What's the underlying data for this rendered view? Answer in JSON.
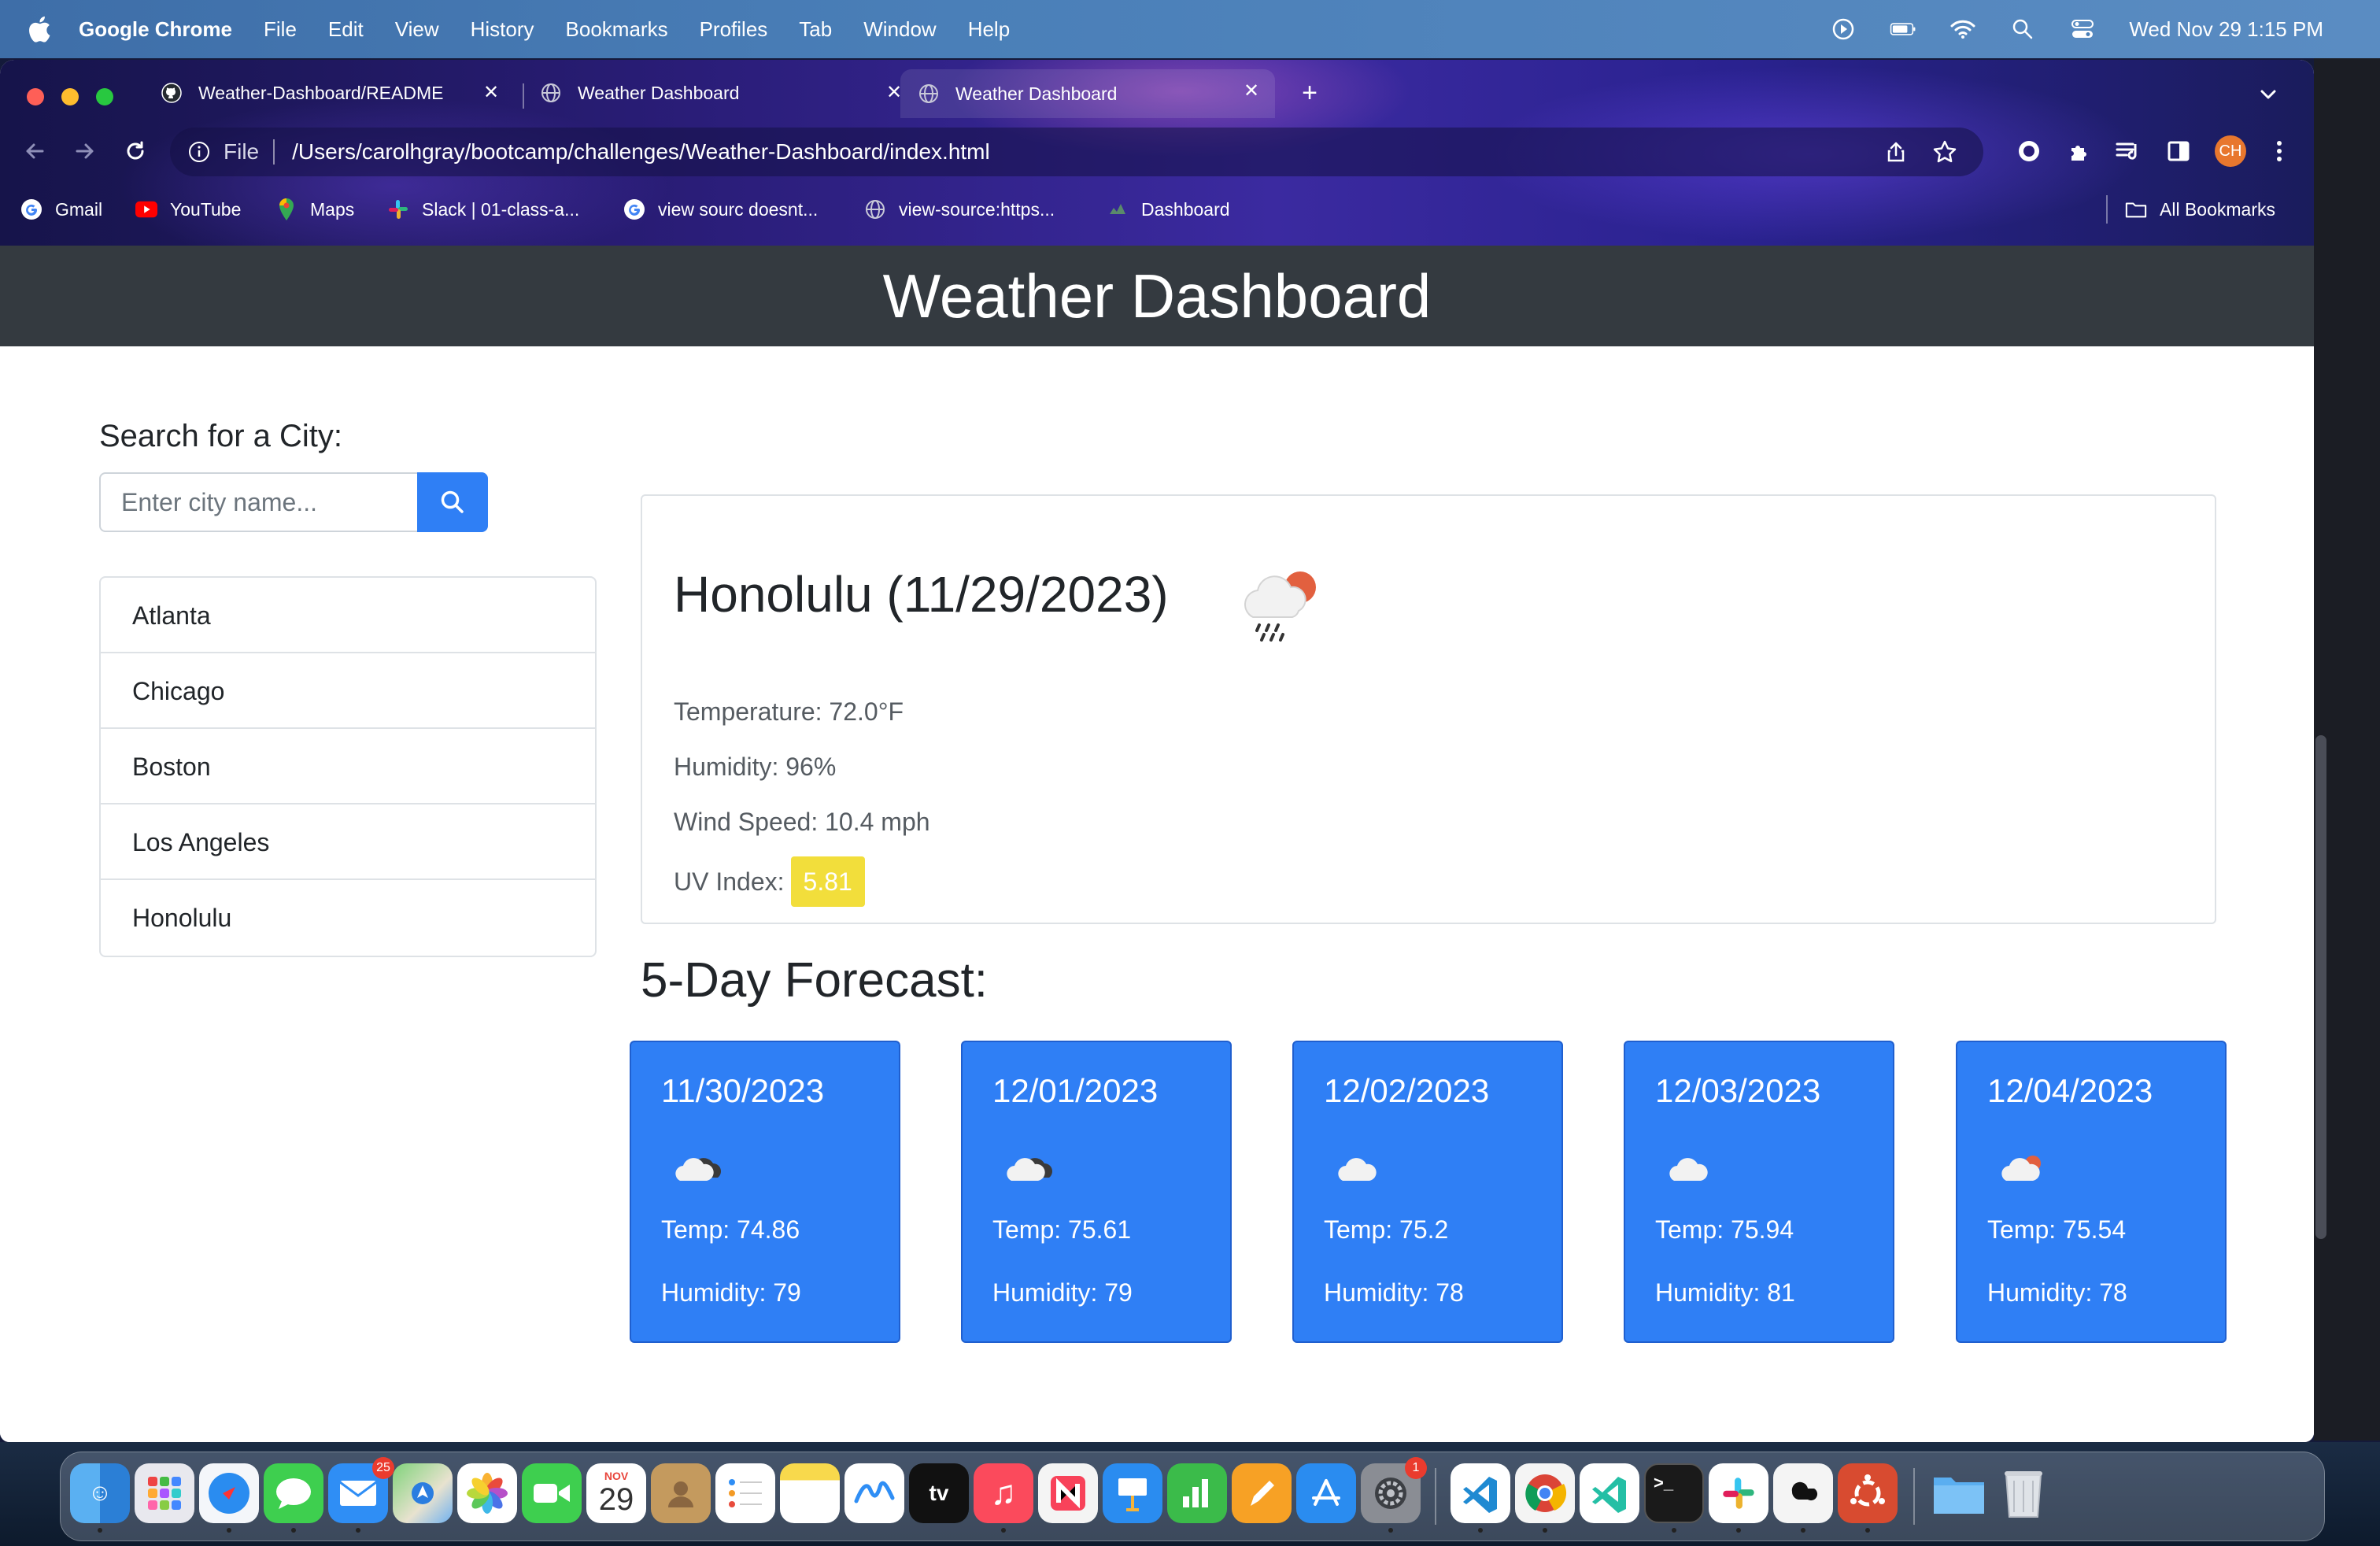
{
  "menubar": {
    "app": "Google Chrome",
    "items": [
      "File",
      "Edit",
      "View",
      "History",
      "Bookmarks",
      "Profiles",
      "Tab",
      "Window",
      "Help"
    ],
    "clock": "Wed Nov 29  1:15 PM"
  },
  "tabs": [
    {
      "title": "Weather-Dashboard/README",
      "icon": "github-icon"
    },
    {
      "title": "Weather Dashboard",
      "icon": "globe-icon"
    },
    {
      "title": "Weather Dashboard",
      "icon": "globe-icon",
      "active": true
    }
  ],
  "omnibox": {
    "scheme": "File",
    "url": "/Users/carolhgray/bootcamp/challenges/Weather-Dashboard/index.html"
  },
  "profile_initials": "CH",
  "bookmarks": [
    {
      "label": "Gmail",
      "icon": "google-icon"
    },
    {
      "label": "YouTube",
      "icon": "youtube-icon"
    },
    {
      "label": "Maps",
      "icon": "maps-pin-icon"
    },
    {
      "label": "Slack | 01-class-a...",
      "icon": "slack-icon"
    },
    {
      "label": "view sourc doesnt...",
      "icon": "google-icon"
    },
    {
      "label": "view-source:https...",
      "icon": "globe-icon"
    },
    {
      "label": "Dashboard",
      "icon": "dashboard-icon"
    }
  ],
  "all_bookmarks": "All Bookmarks",
  "page": {
    "header": "Weather Dashboard",
    "search_title": "Search for a City:",
    "search_placeholder": "Enter city name...",
    "cities": [
      "Atlanta",
      "Chicago",
      "Boston",
      "Los Angeles",
      "Honolulu"
    ],
    "current": {
      "title": "Honolulu (11/29/2023)",
      "icon": "rain-cloud-sun-icon",
      "temperature": "Temperature: 72.0°F",
      "humidity": "Humidity: 96%",
      "wind": "Wind Speed: 10.4 mph",
      "uv_label": "UV Index:",
      "uv_value": "5.81",
      "uv_color": "#f2de3b"
    },
    "forecast_title": "5-Day Forecast:",
    "forecast": [
      {
        "date": "11/30/2023",
        "icon": "broken-clouds-icon",
        "temp": "Temp: 74.86",
        "humidity": "Humidity: 79"
      },
      {
        "date": "12/01/2023",
        "icon": "broken-clouds-icon",
        "temp": "Temp: 75.61",
        "humidity": "Humidity: 79"
      },
      {
        "date": "12/02/2023",
        "icon": "cloud-icon",
        "temp": "Temp: 75.2",
        "humidity": "Humidity: 78"
      },
      {
        "date": "12/03/2023",
        "icon": "cloud-icon",
        "temp": "Temp: 75.94",
        "humidity": "Humidity: 81"
      },
      {
        "date": "12/04/2023",
        "icon": "cloud-sun-icon",
        "temp": "Temp: 75.54",
        "humidity": "Humidity: 78"
      }
    ],
    "accent_color": "#2f7ff5"
  },
  "dock": {
    "calendar_month": "NOV",
    "calendar_day": "29",
    "mail_badge": "25",
    "settings_badge": "1",
    "apps": [
      "finder-icon",
      "launchpad-icon",
      "safari-icon",
      "messages-icon",
      "mail-icon",
      "maps-icon",
      "photos-icon",
      "facetime-icon",
      "calendar-icon",
      "contacts-icon",
      "reminders-icon",
      "notes-icon",
      "freeform-icon",
      "tv-icon",
      "music-icon",
      "news-icon",
      "keynote-icon",
      "numbers-icon",
      "pages-icon",
      "app-store-icon",
      "system-settings-icon",
      "vscode-icon",
      "chrome-icon",
      "vscode-insiders-icon",
      "terminal-icon",
      "slack-icon",
      "github-desktop-icon",
      "ubuntu-icon",
      "downloads-folder-icon",
      "trash-icon"
    ]
  }
}
